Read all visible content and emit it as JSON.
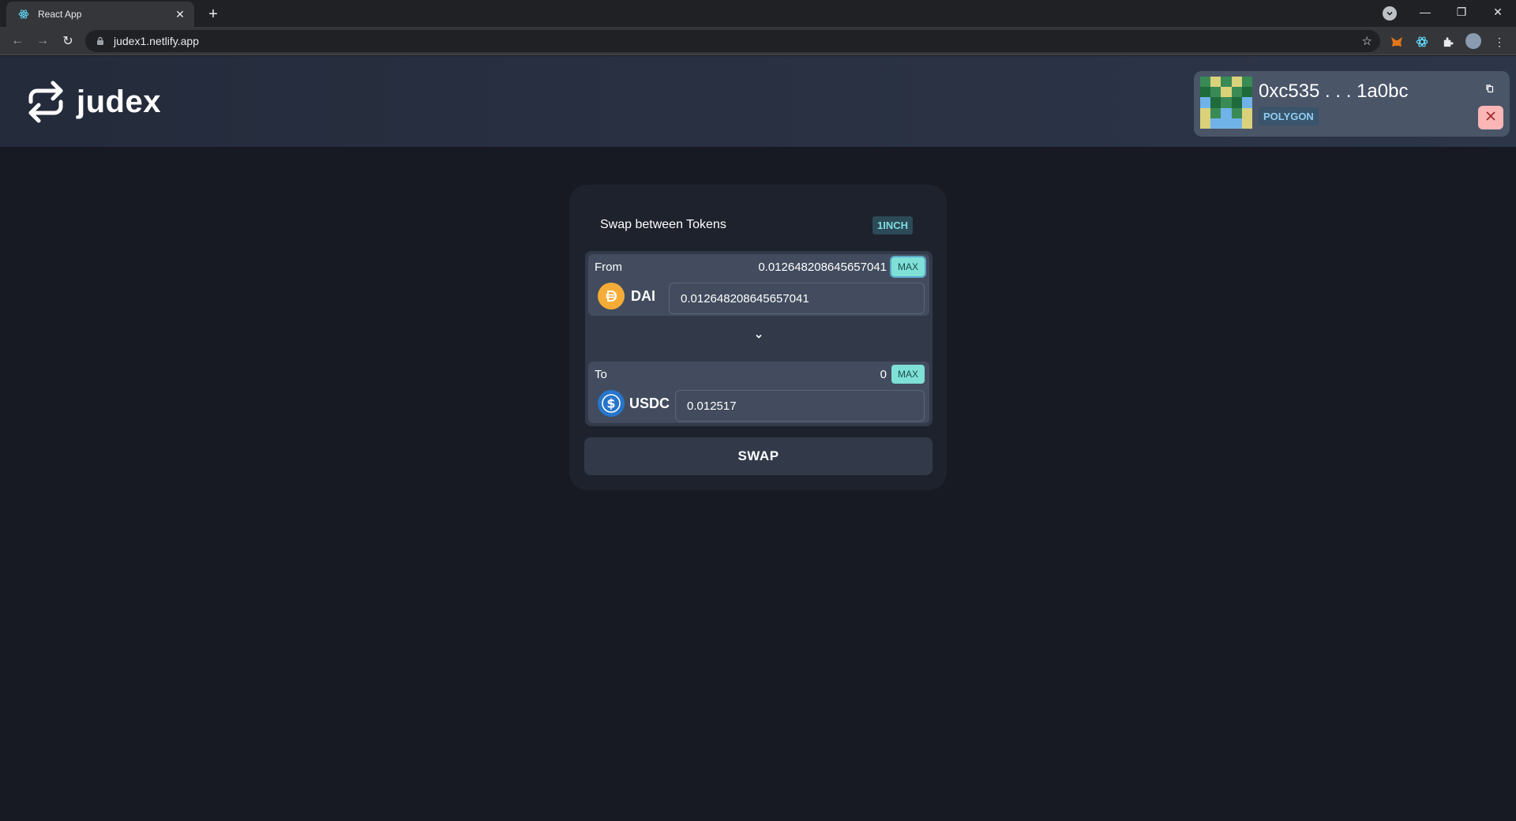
{
  "browser": {
    "tab_title": "React App",
    "url": "judex1.netlify.app"
  },
  "app": {
    "brand_name": "judex"
  },
  "wallet": {
    "address": "0xc535 . . . 1a0bc",
    "network": "POLYGON"
  },
  "swap": {
    "heading": "Swap between Tokens",
    "provider_badge": "1INCH",
    "from": {
      "label": "From",
      "balance": "0.012648208645657041",
      "max_label": "MAX",
      "token_symbol": "DAI",
      "amount": "0.012648208645657041"
    },
    "to": {
      "label": "To",
      "balance": "0",
      "max_label": "MAX",
      "token_symbol": "USDC",
      "amount": "0.012517"
    },
    "button_label": "SWAP"
  },
  "colors": {
    "page_bg": "#171923",
    "header_bg": "#2d3649",
    "card_bg": "#1e222c",
    "max_button": "#7ee0d7",
    "dai": "#f5ac37",
    "usdc": "#2775ca",
    "disconnect": "#fdb6b6"
  },
  "icons": {
    "brand": "swap-arrows-icon",
    "copy": "copy-icon",
    "disconnect": "close-icon",
    "direction": "chevron-down-icon"
  }
}
